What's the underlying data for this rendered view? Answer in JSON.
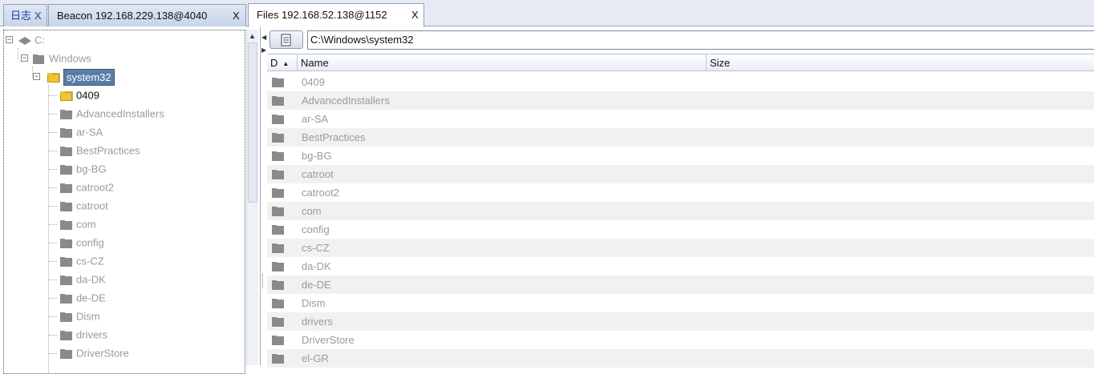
{
  "tabs": [
    {
      "label": "日志",
      "close": "X"
    },
    {
      "label": "Beacon 192.168.229.138@4040",
      "close": "X"
    },
    {
      "label": "Files 192.168.52.138@1152",
      "close": "X"
    }
  ],
  "tree": {
    "root": "C:",
    "windows": "Windows",
    "system32": "system32",
    "children": [
      "0409",
      "AdvancedInstallers",
      "ar-SA",
      "BestPractices",
      "bg-BG",
      "catroot2",
      "catroot",
      "com",
      "config",
      "cs-CZ",
      "da-DK",
      "de-DE",
      "Dism",
      "drivers",
      "DriverStore"
    ]
  },
  "toolbar": {
    "path": "C:\\Windows\\system32"
  },
  "table": {
    "headers": {
      "d": "D",
      "name": "Name",
      "size": "Size"
    },
    "rows": [
      "0409",
      "AdvancedInstallers",
      "ar-SA",
      "BestPractices",
      "bg-BG",
      "catroot",
      "catroot2",
      "com",
      "config",
      "cs-CZ",
      "da-DK",
      "de-DE",
      "Dism",
      "drivers",
      "DriverStore",
      "el-GR"
    ]
  },
  "colors": {
    "folder_gray": "#8a8a8a",
    "folder_yellow": "#f1c232",
    "selection": "#5a7ca8"
  }
}
